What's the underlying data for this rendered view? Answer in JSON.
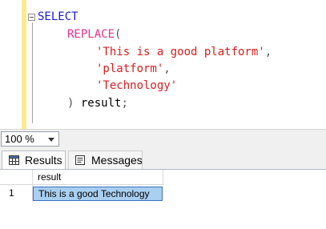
{
  "editor": {
    "lines": [
      {
        "keyword": "SELECT"
      },
      {
        "fn": "REPLACE",
        "paren": "("
      },
      {
        "str": "'This is a good platform'",
        "punc": ","
      },
      {
        "str": "'platform'",
        "punc": ","
      },
      {
        "str": "'Technology'"
      },
      {
        "paren": ")",
        "plain": " result",
        "punc": ";"
      }
    ]
  },
  "zoom": {
    "value": "100 %"
  },
  "tabs": [
    {
      "label": "Results",
      "icon": "grid-icon"
    },
    {
      "label": "Messages",
      "icon": "messages-icon"
    }
  ],
  "results": {
    "columns": [
      "result"
    ],
    "rows": [
      {
        "rownum": "1",
        "values": [
          "This is a good Technology"
        ]
      }
    ]
  }
}
